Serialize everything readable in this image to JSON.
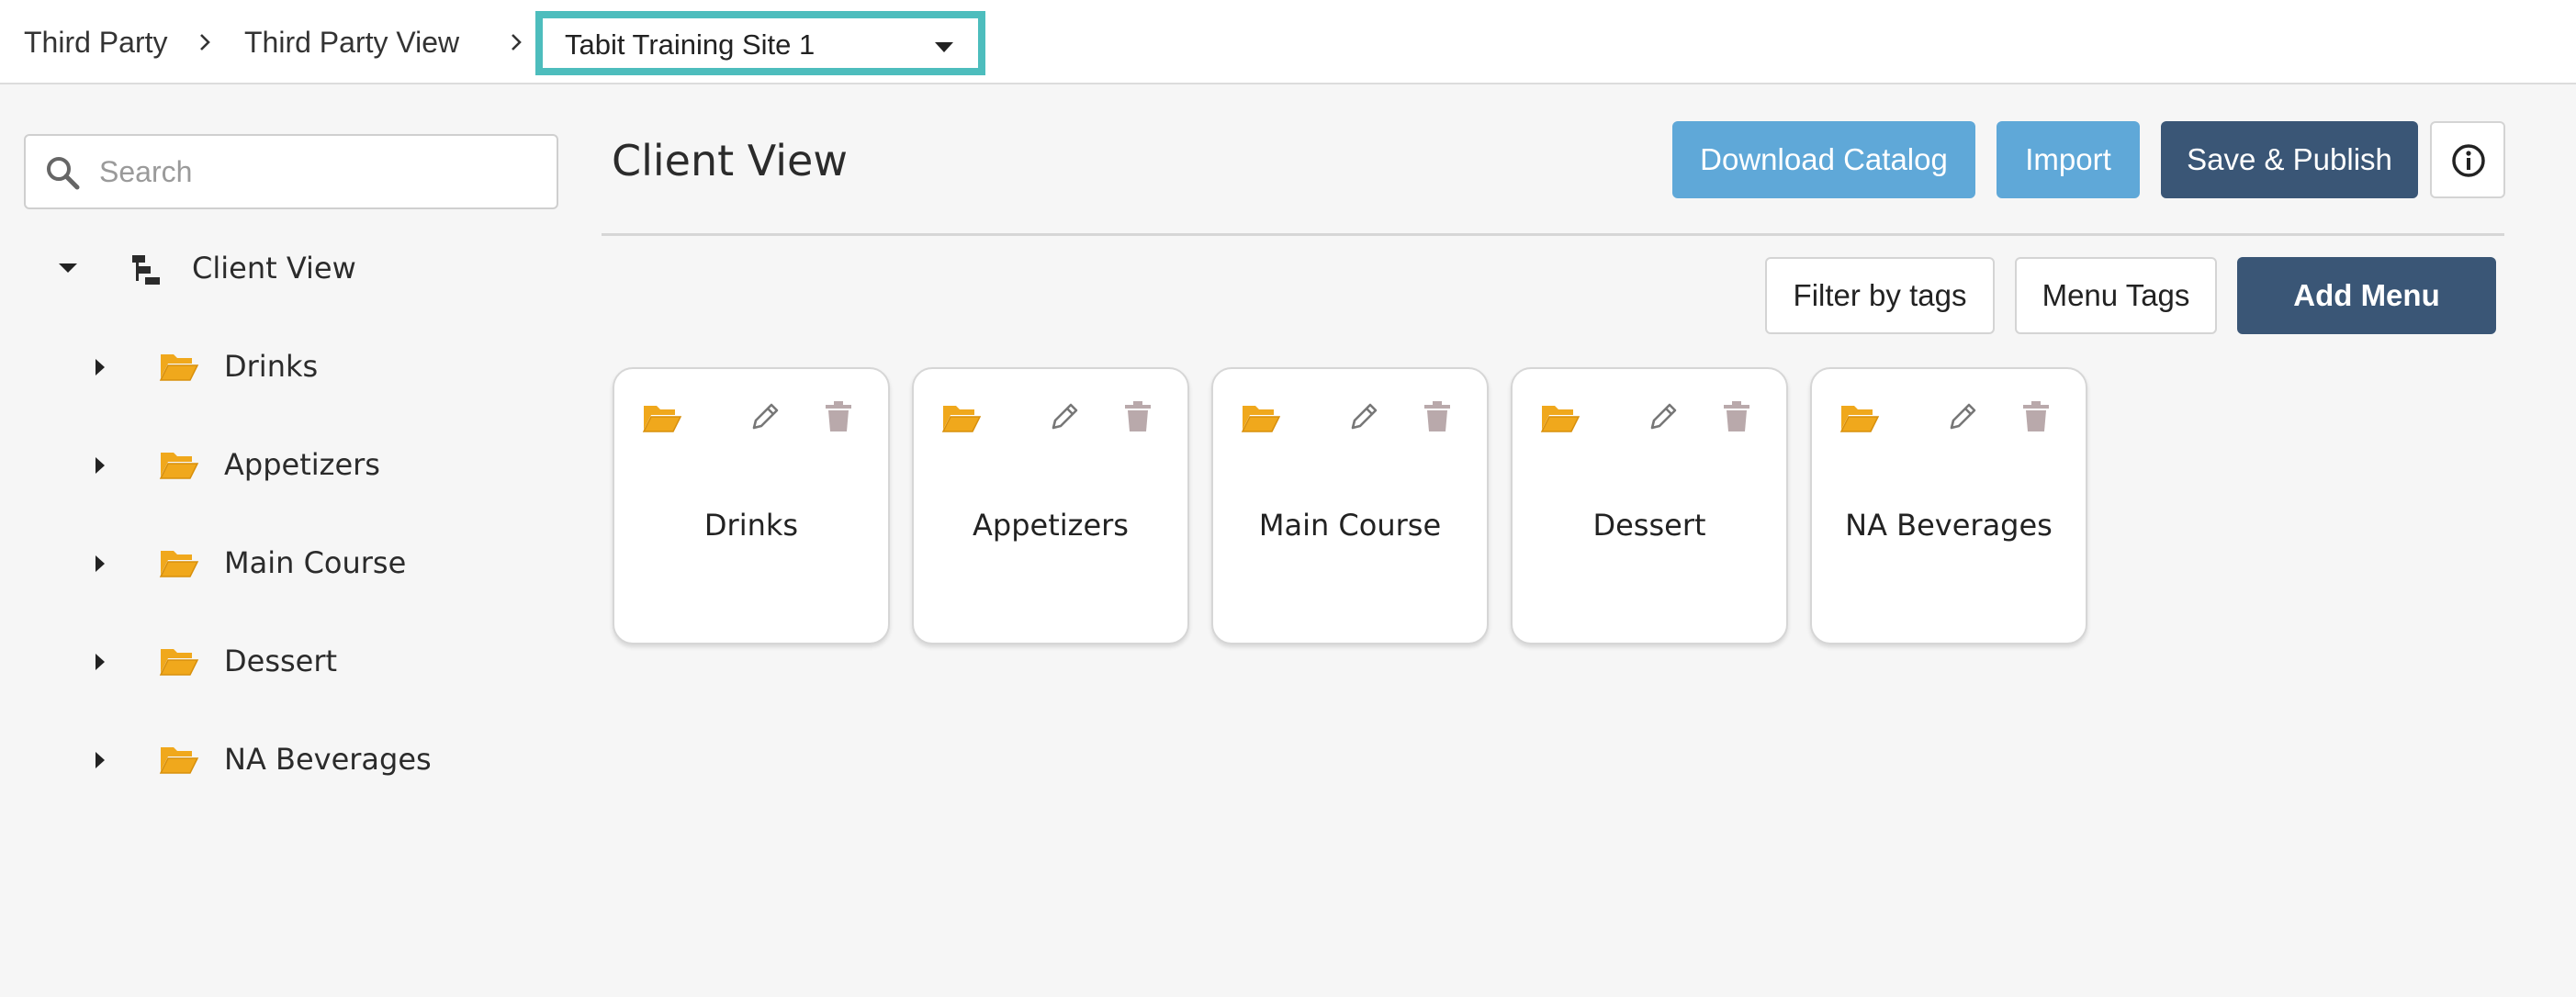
{
  "breadcrumb": {
    "items": [
      "Third Party",
      "Third Party View"
    ],
    "site_select": "Tabit Training Site 1"
  },
  "search": {
    "placeholder": "Search",
    "value": ""
  },
  "tree": {
    "root": "Client View",
    "children": [
      "Drinks",
      "Appetizers",
      "Main Course",
      "Dessert",
      "NA Beverages"
    ]
  },
  "main": {
    "title": "Client View",
    "buttons": {
      "download": "Download Catalog",
      "import": "Import",
      "save_publish": "Save & Publish",
      "filter_tags": "Filter by tags",
      "menu_tags": "Menu Tags",
      "add_menu": "Add Menu"
    },
    "cards": [
      "Drinks",
      "Appetizers",
      "Main Course",
      "Dessert",
      "NA Beverages"
    ]
  },
  "colors": {
    "accent_highlight": "#4dbdbd",
    "button_light": "#5fa8d8",
    "button_dark": "#3a5676",
    "folder": "#f0a81c",
    "trash": "#b9a9ab"
  },
  "icons": {
    "search": "search-icon",
    "info": "info-icon",
    "folder": "folder-open-icon",
    "edit": "pencil-icon",
    "delete": "trash-icon",
    "tree_root": "hierarchy-icon"
  }
}
